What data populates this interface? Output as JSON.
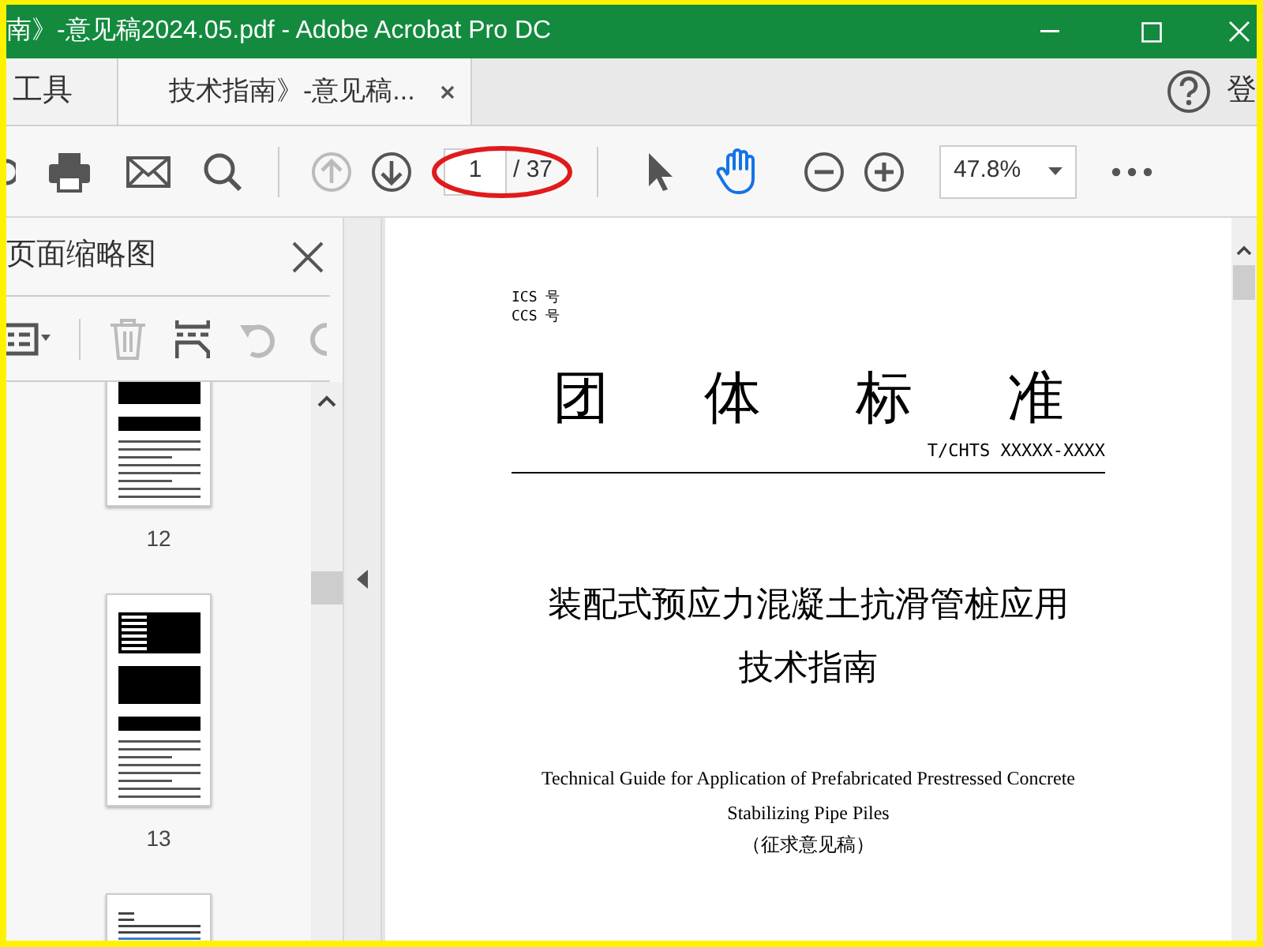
{
  "title_bar": {
    "title": "南》-意见稿2024.05.pdf - Adobe Acrobat Pro DC"
  },
  "tabs": [
    {
      "label": "工具",
      "selected": false,
      "closable": false
    },
    {
      "label": "技术指南》-意见稿...",
      "selected": true,
      "closable": true
    }
  ],
  "account": {
    "label": "登"
  },
  "toolbar": {
    "nav": [
      {
        "kind": "up",
        "disabled": true
      },
      {
        "kind": "down",
        "disabled": false
      }
    ],
    "page_field": {
      "value": "1",
      "total": "/ 37",
      "circled": true
    },
    "tools": [
      {
        "kind": "select",
        "selected": false
      },
      {
        "kind": "hand",
        "selected": true
      }
    ],
    "zoom": {
      "value": "47.8%"
    }
  },
  "sidebar": {
    "title": "页面缩略图",
    "tools": [
      {
        "kind": "options",
        "disabled": false
      },
      {
        "kind": "delete",
        "disabled": true
      },
      {
        "kind": "insert",
        "disabled": false
      },
      {
        "kind": "undo",
        "disabled": true
      },
      {
        "kind": "rotate",
        "disabled": true
      }
    ],
    "thumbnails": [
      {
        "kind": "table",
        "label": "12"
      },
      {
        "kind": "table",
        "label": "13"
      },
      {
        "kind": "text"
      }
    ]
  },
  "document": {
    "codes": [
      "ICS 号",
      "CCS 号"
    ],
    "heading": [
      "团",
      "体",
      "标",
      "准"
    ],
    "number": "T/CHTS XXXXX-XXXX",
    "title": [
      "装配式预应力混凝土抗滑管桩应用",
      "技术指南"
    ],
    "english": [
      "Technical Guide for Application of Prefabricated Prestressed Concrete",
      "Stabilizing Pipe Piles"
    ],
    "status": "（征求意见稿）"
  }
}
